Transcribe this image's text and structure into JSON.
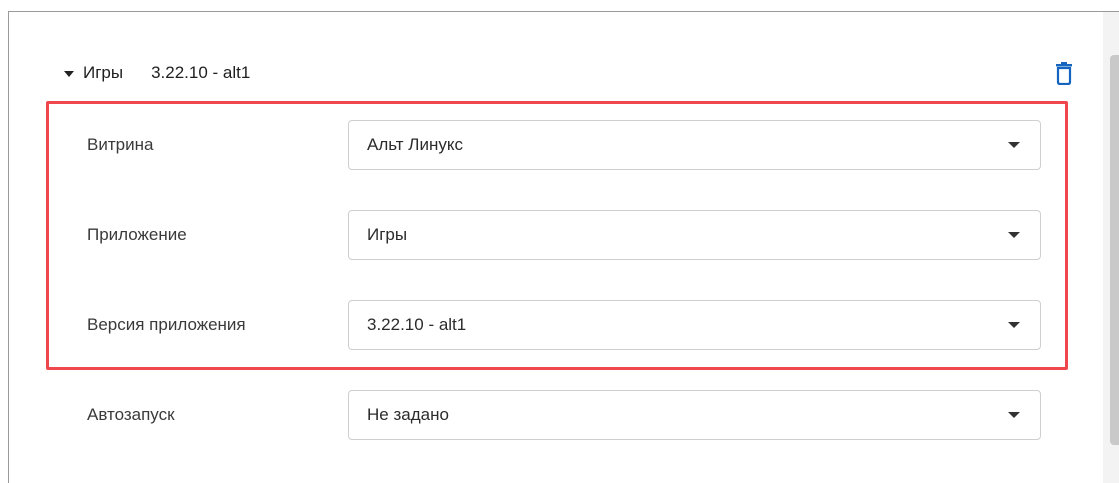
{
  "section": {
    "title": "Игры",
    "version": "3.22.10 - alt1"
  },
  "icons": {
    "collapse": "caret-down-icon",
    "delete": "trash-icon",
    "dropdown": "chevron-down-icon"
  },
  "colors": {
    "highlight": "#f0474f",
    "delete_icon": "#1565c0"
  },
  "fields": [
    {
      "label": "Витрина",
      "value": "Альт Линукс"
    },
    {
      "label": "Приложение",
      "value": "Игры"
    },
    {
      "label": "Версия приложения",
      "value": "3.22.10 - alt1"
    },
    {
      "label": "Автозапуск",
      "value": "Не задано"
    }
  ]
}
